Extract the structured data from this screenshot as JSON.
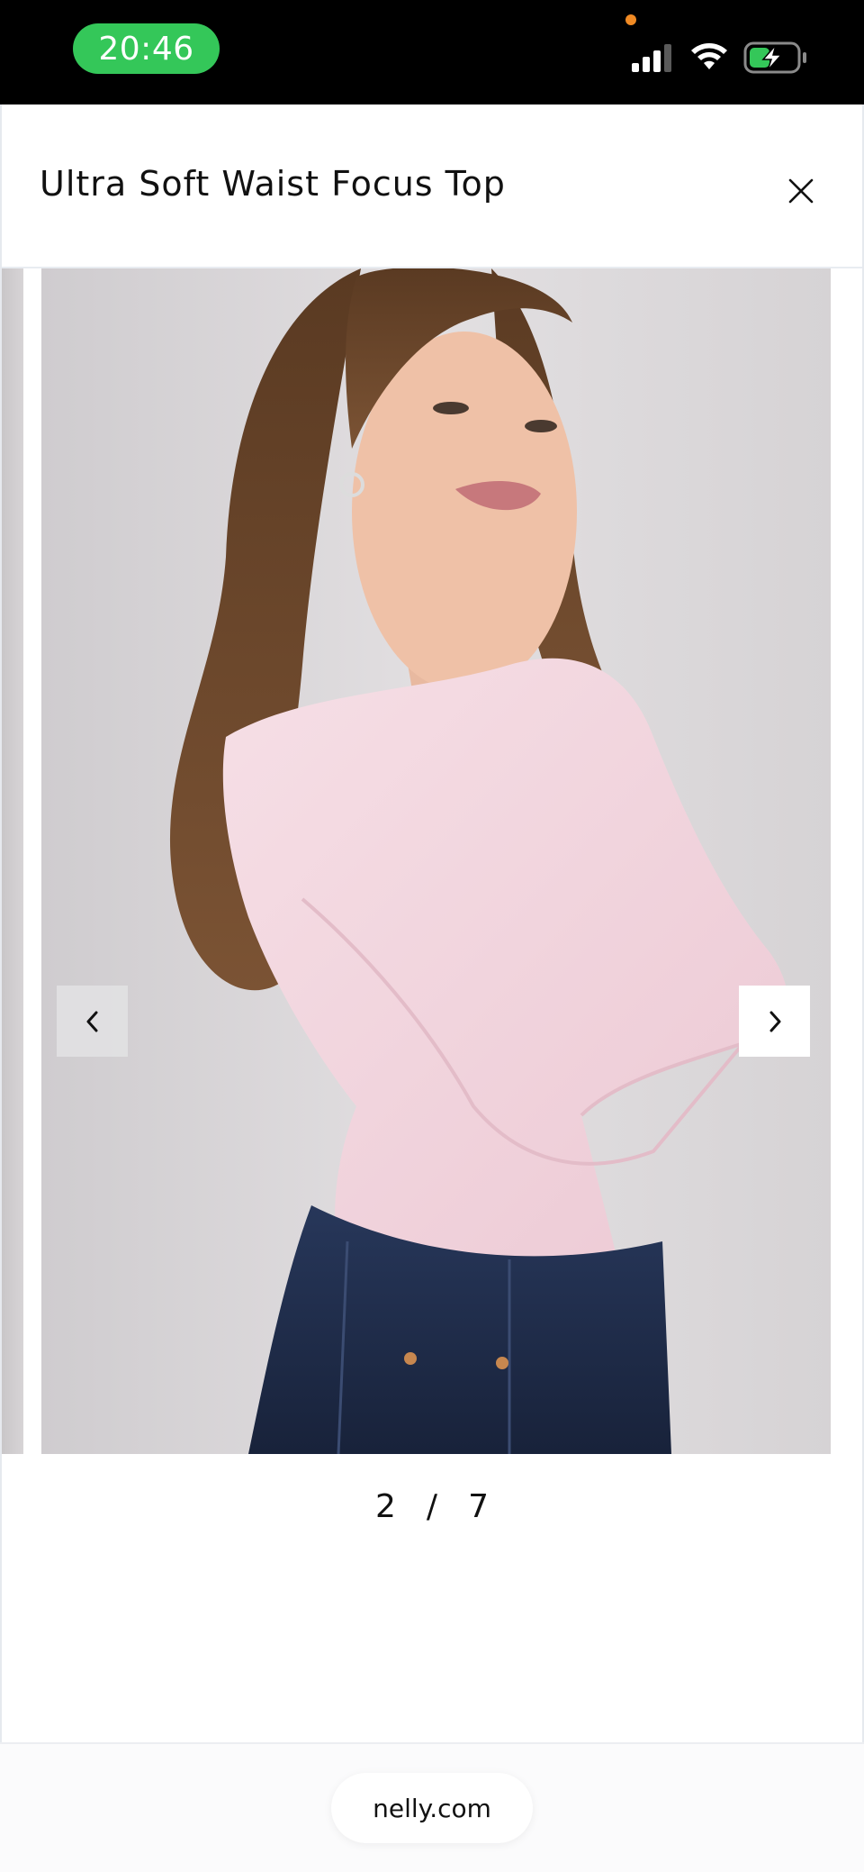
{
  "status_bar": {
    "time": "20:46",
    "time_pill_color": "#34c759",
    "icons": [
      "signal-icon",
      "wifi-icon",
      "battery-charging-icon"
    ]
  },
  "modal": {
    "title": "Ultra Soft Waist Focus Top",
    "close_icon": "close-icon"
  },
  "gallery": {
    "current": "2",
    "separator": "/",
    "total": "7",
    "prev_icon": "chevron-left-icon",
    "next_icon": "chevron-right-icon",
    "image_description_colors": {
      "background": "#dcd9db",
      "top": "#f2d5de",
      "jeans": "#1f2c48",
      "hair": "#6b4428"
    }
  },
  "browser": {
    "url": "nelly.com"
  }
}
